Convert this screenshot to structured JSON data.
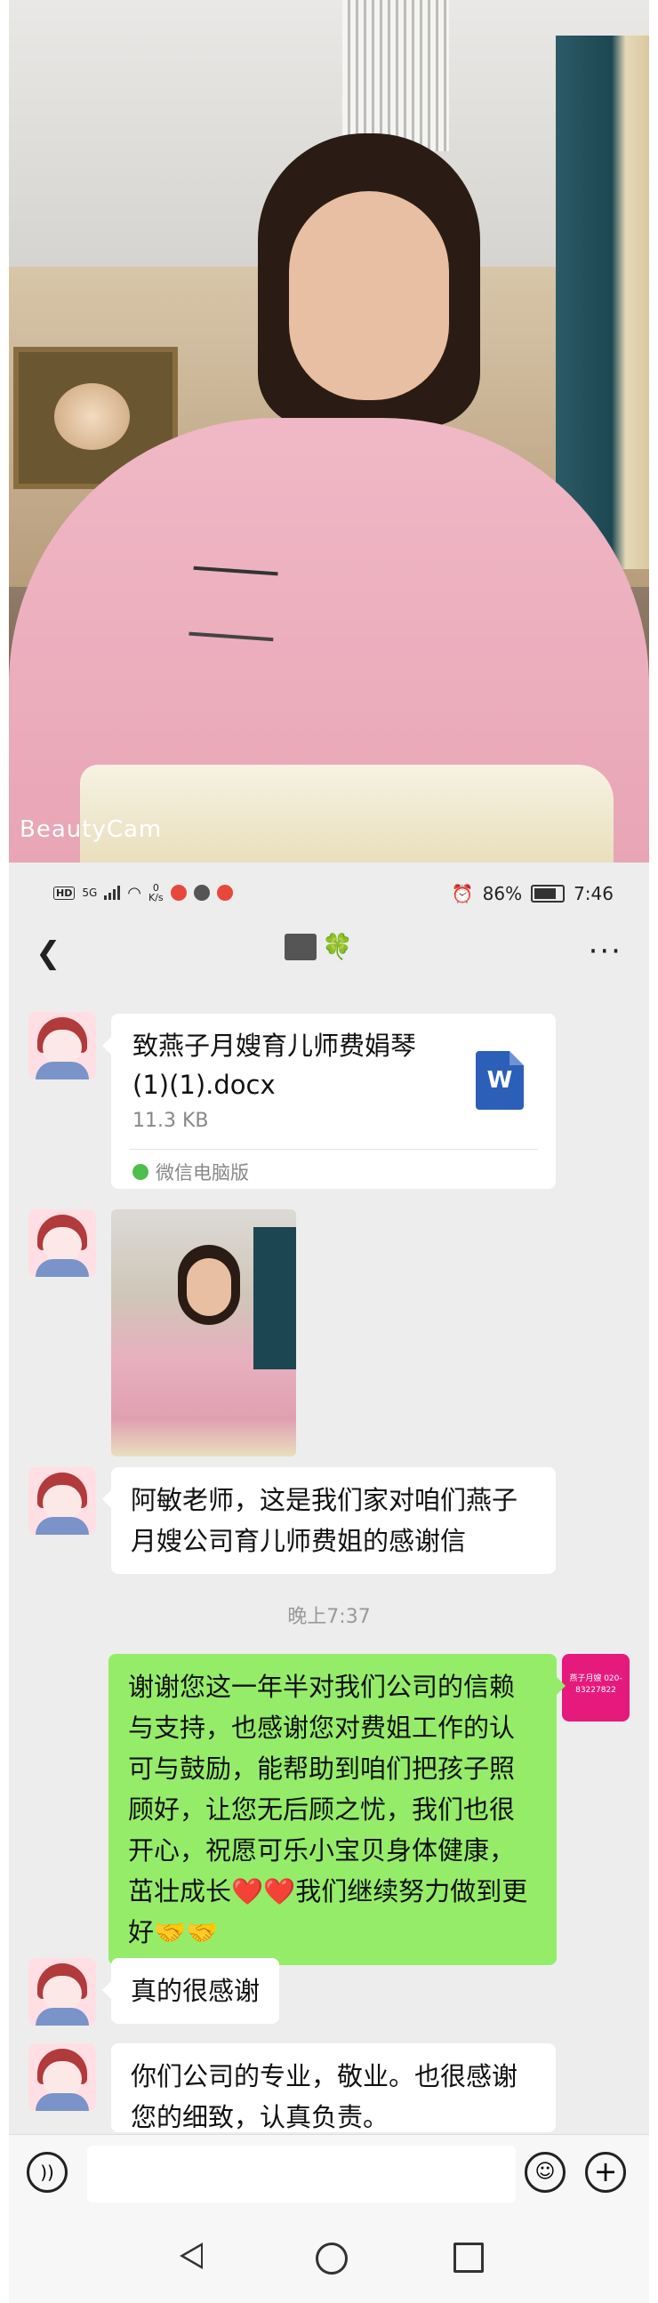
{
  "photo": {
    "watermark": "BeautyCam"
  },
  "status_bar": {
    "signal_type": "5G",
    "speed_value": "0",
    "speed_unit": "K/s",
    "battery": "86%",
    "time": "7:46"
  },
  "chat": {
    "back_icon": "chevron-left",
    "more_icon": "more-dots",
    "title_emoji": "🍀"
  },
  "messages": [
    {
      "type": "file",
      "sender": "other",
      "file_name": "致燕子月嫂育儿师费娟琴(1)(1).docx",
      "file_size": "11.3 KB",
      "file_icon_letter": "W",
      "source": "微信电脑版"
    },
    {
      "type": "image",
      "sender": "other"
    },
    {
      "type": "text",
      "sender": "other",
      "text": "阿敏老师，这是我们家对咱们燕子月嫂公司育儿师费姐的感谢信"
    },
    {
      "type": "time",
      "text": "晚上7:37"
    },
    {
      "type": "text",
      "sender": "self",
      "text": "谢谢您这一年半对我们公司的信赖与支持，也感谢您对费姐工作的认可与鼓励，能帮助到咱们把孩子照顾好，让您无后顾之忧，我们也很开心，祝愿可乐小宝贝身体健康，茁壮成长❤️❤️我们继续努力做到更好🤝🤝"
    },
    {
      "type": "text",
      "sender": "other",
      "text": "真的很感谢"
    },
    {
      "type": "text",
      "sender": "other",
      "text": "你们公司的专业，敬业。也很感谢您的细致，认真负责。"
    }
  ],
  "self_avatar_text": "燕子月嫂 020-83227822",
  "input_bar": {
    "placeholder": ""
  }
}
